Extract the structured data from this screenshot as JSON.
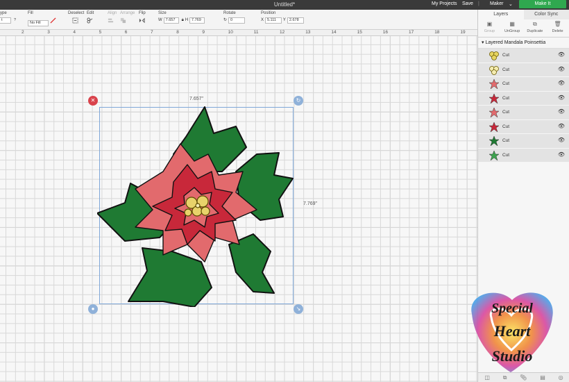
{
  "topbar": {
    "title": "Untitled*",
    "my_projects": "My Projects",
    "save": "Save",
    "machine": "Maker",
    "make_it": "Make It"
  },
  "toolbar": {
    "type_label": "ype",
    "type_value": "t",
    "fill_label": "Fill",
    "fill_value": "No Fill",
    "deselect_label": "Deselect",
    "edit_label": "Edit",
    "align_label": "Align",
    "arrange_label": "Arrange",
    "flip_label": "Flip",
    "size_label": "Size",
    "w_label": "W",
    "w_value": "7.657",
    "h_label": "H",
    "h_value": "7.769",
    "rotate_label": "Rotate",
    "rotate_value": "0",
    "position_label": "Position",
    "x_label": "X",
    "x_value": "5.111",
    "y_label": "Y",
    "y_value": "2.678"
  },
  "ruler": {
    "numbers": [
      "2",
      "3",
      "4",
      "5",
      "6",
      "7",
      "8",
      "9",
      "10",
      "11",
      "12",
      "13",
      "14",
      "15",
      "16",
      "17",
      "18",
      "19"
    ]
  },
  "canvas": {
    "width_readout": "7.657\"",
    "height_readout": "7.769\"",
    "colors": {
      "dark_green": "#1f7a33",
      "light_green": "#3da34e",
      "red": "#c8283a",
      "pink": "#e26a6d",
      "gold": "#e8d36a",
      "cream": "#f4ecb0"
    }
  },
  "panel": {
    "tab_layers": "Layers",
    "tab_color_sync": "Color Sync",
    "actions": [
      {
        "label": "Group",
        "icon": "group-icon"
      },
      {
        "label": "UnGroup",
        "icon": "ungroup-icon"
      },
      {
        "label": "Duplicate",
        "icon": "duplicate-icon"
      },
      {
        "label": "Delete",
        "icon": "trash-icon"
      }
    ],
    "group_name": "Layered Mandala Poinsettia",
    "layers": [
      {
        "label": "Cut",
        "color": "#e6d45f",
        "icon": "circles-icon"
      },
      {
        "label": "Cut",
        "color": "#f4ecb0",
        "icon": "circles-icon"
      },
      {
        "label": "Cut",
        "color": "#e26a6d",
        "icon": "star-icon"
      },
      {
        "label": "Cut",
        "color": "#c8283a",
        "icon": "star-icon"
      },
      {
        "label": "Cut",
        "color": "#e26a6d",
        "icon": "star-icon"
      },
      {
        "label": "Cut",
        "color": "#c8283a",
        "icon": "star-icon"
      },
      {
        "label": "Cut",
        "color": "#1f7a33",
        "icon": "star-icon"
      },
      {
        "label": "Cut",
        "color": "#3da34e",
        "icon": "star-icon"
      }
    ]
  },
  "logo": {
    "line1": "Special",
    "line2": "Heart",
    "line3": "Studio"
  }
}
